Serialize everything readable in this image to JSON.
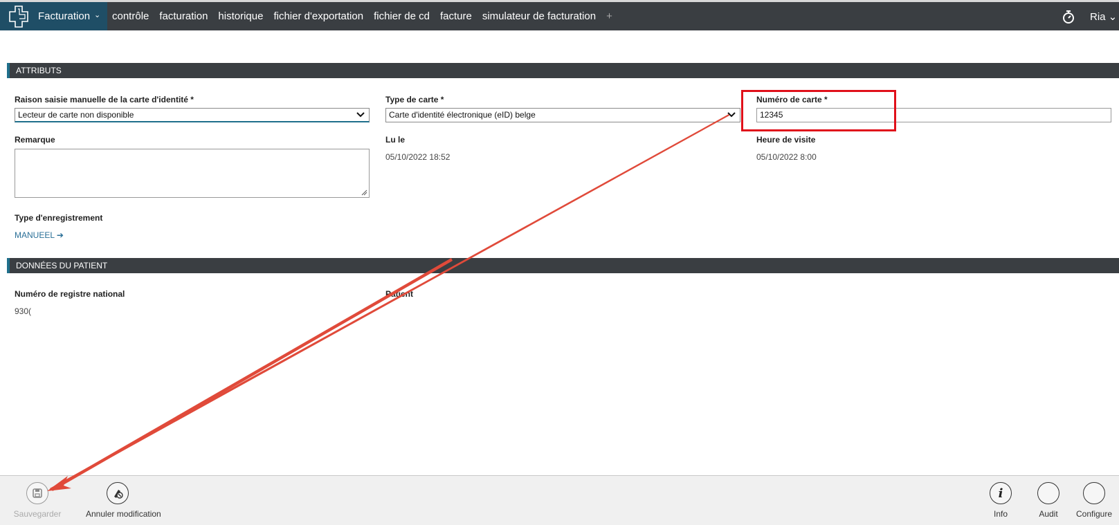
{
  "topbar": {
    "module": "Facturation",
    "nav": [
      "contrôle",
      "facturation",
      "historique",
      "fichier d'exportation",
      "fichier de cd",
      "facture",
      "simulateur de facturation"
    ],
    "plus": "+",
    "user": "Ria ⌄"
  },
  "attributs": {
    "header": "ATTRIBUTS",
    "raison_label": "Raison saisie manuelle de la carte d'identité *",
    "raison_value": "Lecteur de carte non disponible",
    "type_label": "Type de carte *",
    "type_value": "Carte d'identité électronique (eID) belge",
    "numero_label": "Numéro de carte *",
    "numero_value": "12345",
    "remarque_label": "Remarque",
    "remarque_value": "",
    "lu_le_label": "Lu le",
    "lu_le_value": "05/10/2022 18:52",
    "heure_label": "Heure de visite",
    "heure_value": "05/10/2022 8:00",
    "enregistrement_label": "Type d'enregistrement",
    "enregistrement_value": "MANUEEL ➔"
  },
  "patient": {
    "header": "DONNÉES DU PATIENT",
    "registre_label": "Numéro de registre national",
    "registre_value": "930(",
    "patient_label": "Patient"
  },
  "footer": {
    "save": "Sauvegarder",
    "cancel": "Annuler modification",
    "info": "Info",
    "audit": "Audit",
    "configure": "Configure"
  },
  "colors": {
    "annotation_red": "#e0101a",
    "arrow": "#e04a3a",
    "accent": "#1f6f8b"
  }
}
